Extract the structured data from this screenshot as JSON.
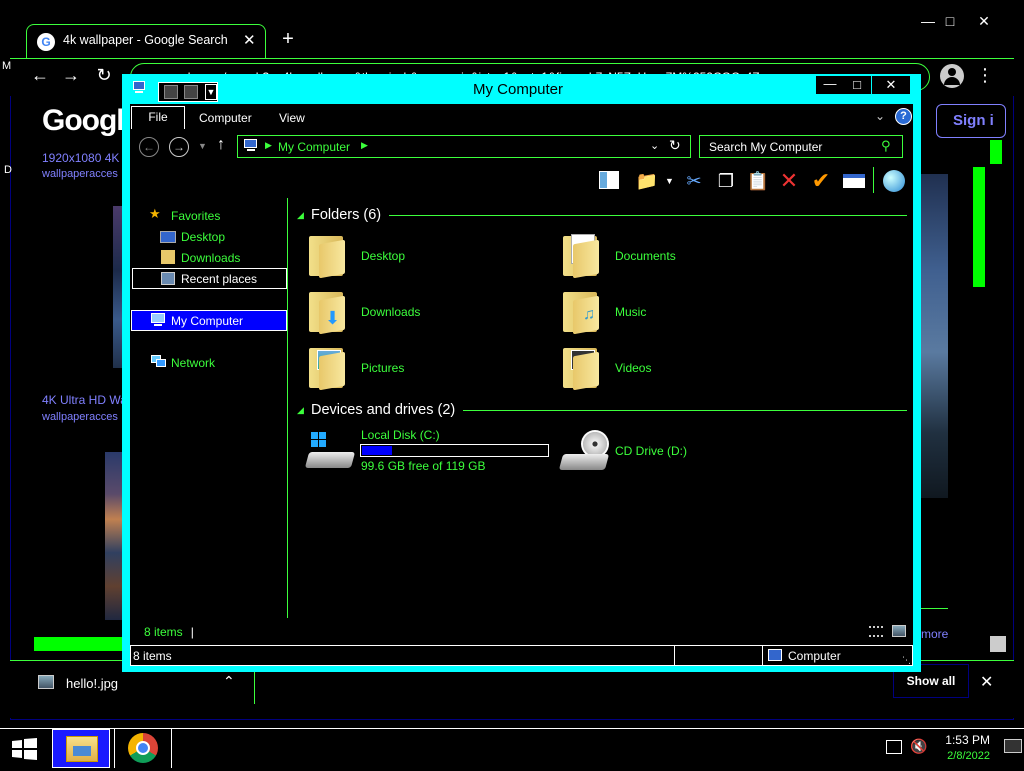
{
  "chrome": {
    "tab_title": "4k wallpaper - Google Search",
    "tab_close": "✕",
    "new_tab": "+",
    "url": "google.com/search?q=4k+wallpaper&tbm=isch&source=iu&ictx=1&vet=1&fir=...ch7vN5ZeHuyu7M%252CGCc4Z...",
    "google_logo": "Google",
    "result1_title": "1920x1080 4K",
    "result1_source": "wallpaperacces",
    "result2_title": "4K Ultra HD Wa",
    "result2_source": "wallpaperacces",
    "sign_in": "Sign i",
    "more": "more",
    "side_letter_m": "M",
    "side_letter_d": "D",
    "download_file": "hello!.jpg",
    "show_all": "Show all"
  },
  "explorer": {
    "title": "My Computer",
    "ribbon_tabs": [
      "File",
      "Computer",
      "View"
    ],
    "address": "My Computer",
    "search_placeholder": "Search My Computer",
    "nav": {
      "favorites": "Favorites",
      "desktop": "Desktop",
      "downloads": "Downloads",
      "recent": "Recent places",
      "mycomputer": "My Computer",
      "network": "Network"
    },
    "folders_header": "Folders (6)",
    "folders": [
      "Desktop",
      "Documents",
      "Downloads",
      "Music",
      "Pictures",
      "Videos"
    ],
    "drives_header": "Devices and drives (2)",
    "drive_c_name": "Local Disk (C:)",
    "drive_c_free": "99.6 GB free of 119 GB",
    "drive_c_used_fraction": 0.163,
    "drive_d_name": "CD Drive (D:)",
    "items_inner": "8 items",
    "status_items": "8 items",
    "status_location": "Computer"
  },
  "taskbar": {
    "time": "1:53 PM",
    "date": "2/8/2022"
  },
  "colors": {
    "accent_green": "#3cff3c",
    "window_frame": "#00ffff",
    "selection_blue": "#0000ff",
    "link_purple": "#8080ff"
  }
}
